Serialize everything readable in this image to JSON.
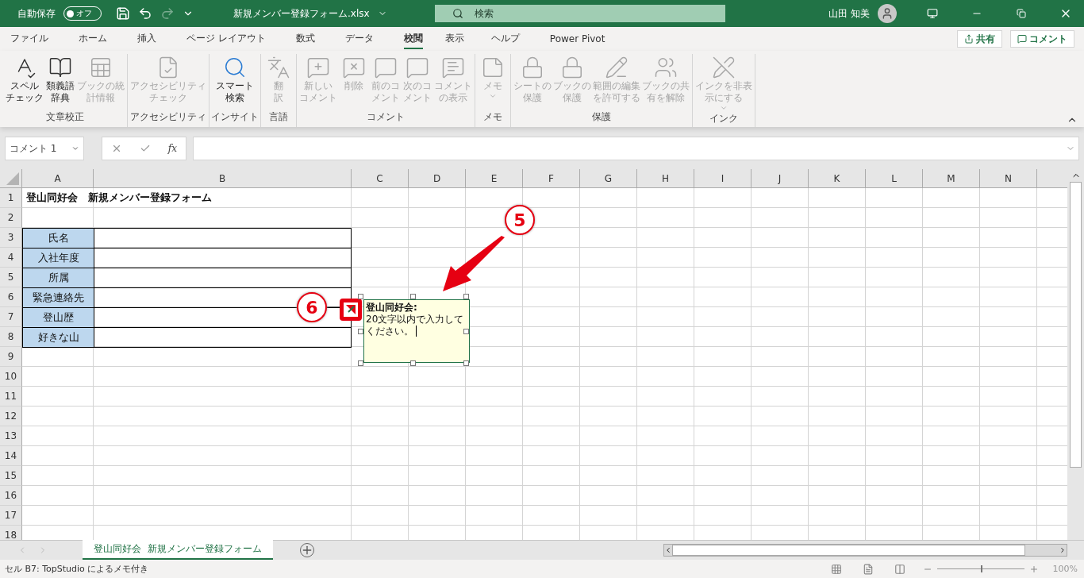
{
  "title_bar": {
    "autosave": {
      "label": "自動保存",
      "on": false,
      "state_text": "オフ"
    },
    "redo": {
      "disabled": true
    },
    "file_name": "新規メンバー登録フォーム.xlsx",
    "search": {
      "placeholder": "検索"
    },
    "user_name": "山田 知美"
  },
  "ribbon_tabs": [
    {
      "label": "ファイル",
      "selected": false
    },
    {
      "label": "ホーム",
      "selected": false
    },
    {
      "label": "挿入",
      "selected": false
    },
    {
      "label": "ページ レイアウト",
      "selected": false
    },
    {
      "label": "数式",
      "selected": false
    },
    {
      "label": "データ",
      "selected": false
    },
    {
      "label": "校閲",
      "selected": true
    },
    {
      "label": "表示",
      "selected": false
    },
    {
      "label": "ヘルプ",
      "selected": false
    },
    {
      "label": "Power Pivot",
      "selected": false
    }
  ],
  "share_buttons": [
    "共有",
    "コメント"
  ],
  "ribbon_groups": [
    {
      "label": "文章校正",
      "buttons": [
        {
          "label_lines": [
            "スペル",
            "チェック"
          ],
          "disabled": false
        },
        {
          "label_lines": [
            "類義語",
            "辞典"
          ],
          "disabled": false
        },
        {
          "label_lines": [
            "ブックの統",
            "計情報"
          ],
          "disabled": true
        }
      ]
    },
    {
      "label": "アクセシビリティ",
      "buttons": [
        {
          "label_lines": [
            "アクセシビリティ",
            "チェック"
          ],
          "disabled": true
        }
      ]
    },
    {
      "label": "インサイト",
      "buttons": [
        {
          "label_lines": [
            "スマート",
            "検索"
          ],
          "disabled": false
        }
      ]
    },
    {
      "label": "言語",
      "buttons": [
        {
          "label_lines": [
            "翻",
            "訳"
          ],
          "disabled": true
        }
      ]
    },
    {
      "label": "コメント",
      "buttons": [
        {
          "label_lines": [
            "新しい",
            "コメント"
          ],
          "disabled": true
        },
        {
          "label_lines": [
            "削除"
          ],
          "disabled": true
        },
        {
          "label_lines": [
            "前のコ",
            "メント"
          ],
          "disabled": true
        },
        {
          "label_lines": [
            "次のコ",
            "メント"
          ],
          "disabled": true
        },
        {
          "label_lines": [
            "コメント",
            "の表示"
          ],
          "disabled": true
        }
      ]
    },
    {
      "label": "メモ",
      "buttons": [
        {
          "label_lines": [
            "メモ"
          ],
          "disabled": true,
          "dropdown": true
        }
      ]
    },
    {
      "label": "保護",
      "buttons": [
        {
          "label_lines": [
            "シートの",
            "保護"
          ],
          "disabled": true
        },
        {
          "label_lines": [
            "ブックの",
            "保護"
          ],
          "disabled": true
        },
        {
          "label_lines": [
            "範囲の編集",
            "を許可する"
          ],
          "disabled": true
        },
        {
          "label_lines": [
            "ブックの共",
            "有を解除"
          ],
          "disabled": true
        }
      ]
    },
    {
      "label": "インク",
      "buttons": [
        {
          "label_lines": [
            "インクを非表",
            "示にする"
          ],
          "disabled": true,
          "dropdown": true
        }
      ]
    }
  ],
  "formula_bar": {
    "name_box": "コメント 1",
    "function_label": "fx"
  },
  "sheet": {
    "columns": [
      "A",
      "B",
      "C",
      "D",
      "E",
      "F",
      "G",
      "H",
      "I",
      "J",
      "K",
      "L",
      "M",
      "N"
    ],
    "row_numbers": [
      "1",
      "2",
      "3",
      "4",
      "5",
      "6",
      "7",
      "8",
      "9",
      "10",
      "11",
      "12",
      "13",
      "14",
      "15",
      "16",
      "17",
      "18"
    ],
    "title_cell": "登山同好会　新規メンバー登録フォーム",
    "form_fields": [
      {
        "label": "氏名"
      },
      {
        "label": "入社年度"
      },
      {
        "label": "所属"
      },
      {
        "label": "緊急連絡先"
      },
      {
        "label": "登山歴"
      },
      {
        "label": "好きな山"
      }
    ],
    "comment": {
      "author": "登山同好会:",
      "text": "20文字以内で入力してください。"
    },
    "callouts": [
      {
        "number": "5"
      },
      {
        "number": "6"
      }
    ]
  },
  "sheet_tabs": [
    {
      "label": "登山同好会  新規メンバー登録フォーム",
      "selected": true
    }
  ],
  "status_bar": {
    "text": "セル B7: TopStudio によるメモ付き",
    "zoom": {
      "level": 0.5,
      "reading": "100%"
    }
  }
}
